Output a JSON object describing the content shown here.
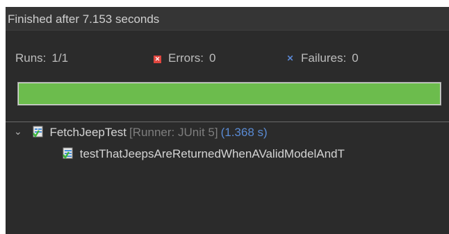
{
  "status": {
    "finished_text": "Finished after 7.153 seconds"
  },
  "counters": {
    "runs_label": "Runs:",
    "runs_value": "1/1",
    "errors_label": "Errors:",
    "errors_value": "0",
    "failures_label": "Failures:",
    "failures_value": "0"
  },
  "progress": {
    "fraction": 1.0,
    "color": "#6cbc4d"
  },
  "tree": {
    "suite": {
      "name": "FetchJeepTest",
      "runner": "[Runner: JUnit 5]",
      "time": "(1.368 s)",
      "expanded": true,
      "icon": "test-suite-passed-icon"
    },
    "tests": [
      {
        "name": "testThatJeepsAreReturnedWhenAValidModelAndT",
        "icon": "test-passed-icon"
      }
    ]
  },
  "colors": {
    "panel_bg": "#2b2b2b",
    "error_red": "#e0463f",
    "failure_blue": "#5b88d4",
    "timing_blue": "#5a8bd4",
    "success_green": "#6cbc4d"
  }
}
